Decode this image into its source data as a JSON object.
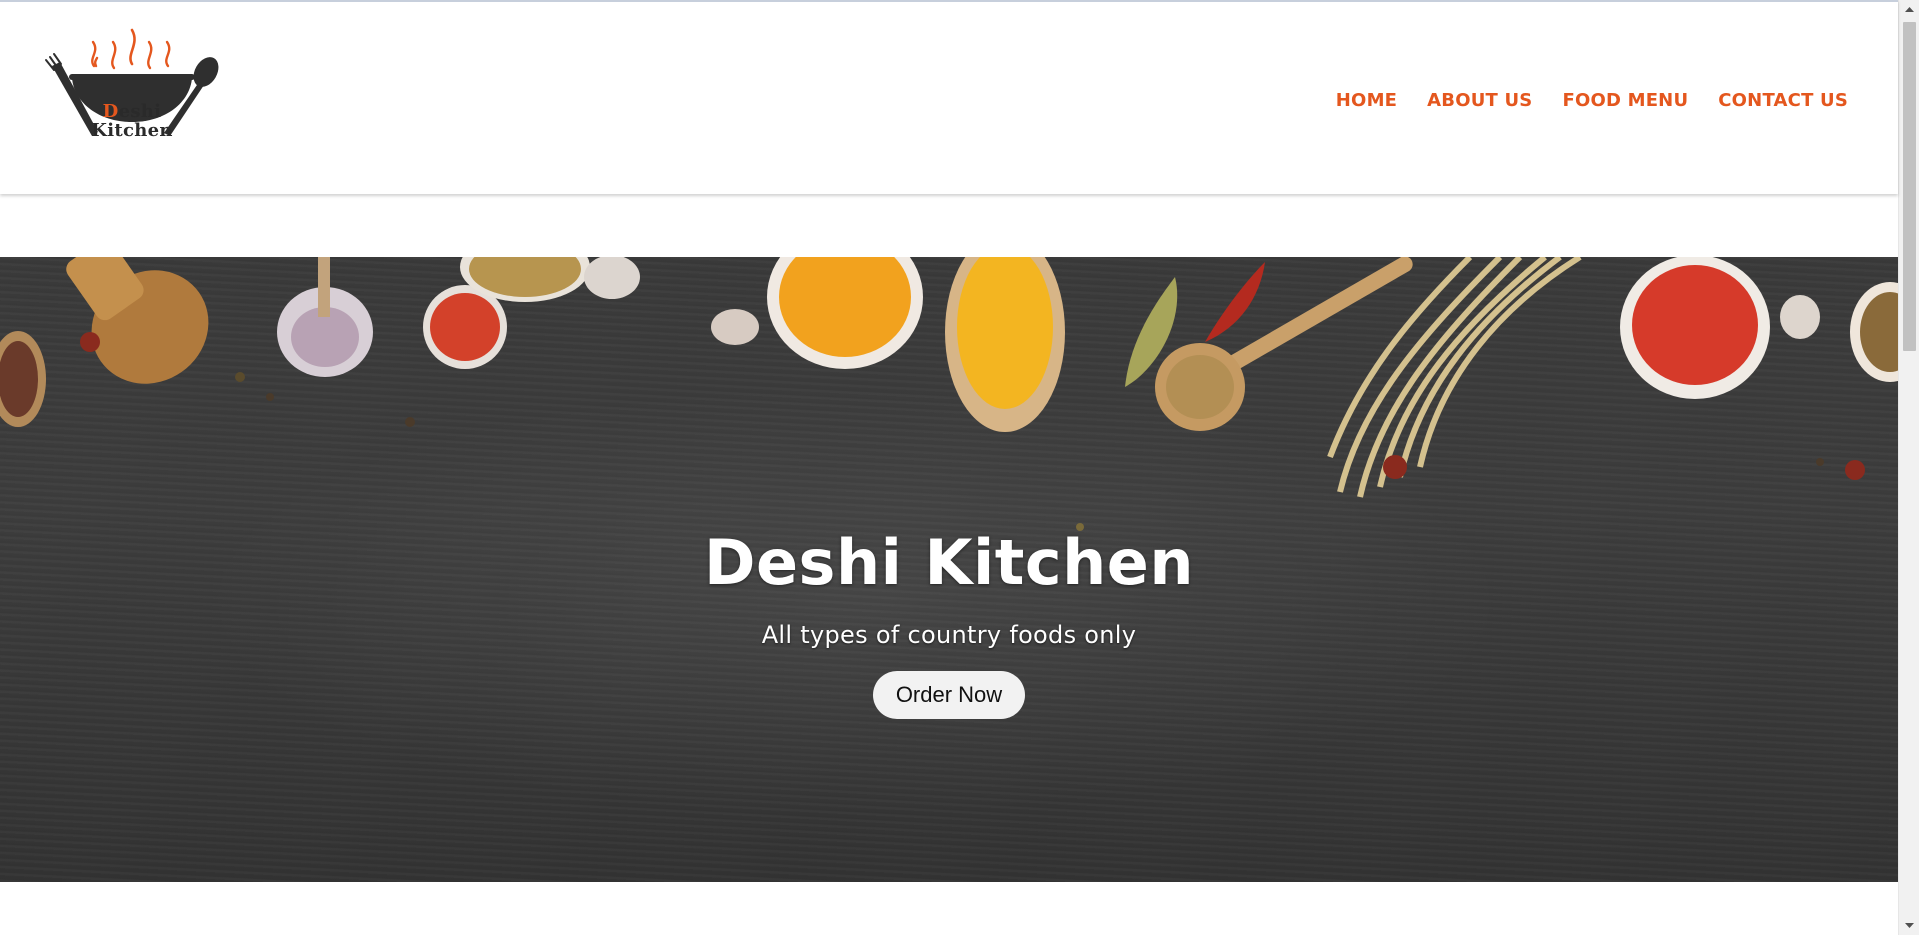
{
  "header": {
    "logo": {
      "line1_initial": "D",
      "line1_rest": "eshi",
      "line2": "Kitchen",
      "icon": "wok-with-fork-and-spoon-icon"
    },
    "nav": [
      {
        "label": "HOME"
      },
      {
        "label": "ABOUT US"
      },
      {
        "label": "FOOD MENU"
      },
      {
        "label": "CONTACT US"
      }
    ]
  },
  "hero": {
    "title": "Deshi Kitchen",
    "subtitle": "All types of country foods only",
    "button_label": "Order Now",
    "background": "spices-on-dark-wooden-table"
  },
  "colors": {
    "accent": "#e4571e",
    "hero_background": "#3a3a3a",
    "button_background": "#f2f2f2",
    "header_background": "#ffffff"
  },
  "scrollbar": {
    "icon_up": "scroll-up-arrow-icon",
    "icon_down": "scroll-down-arrow-icon"
  }
}
